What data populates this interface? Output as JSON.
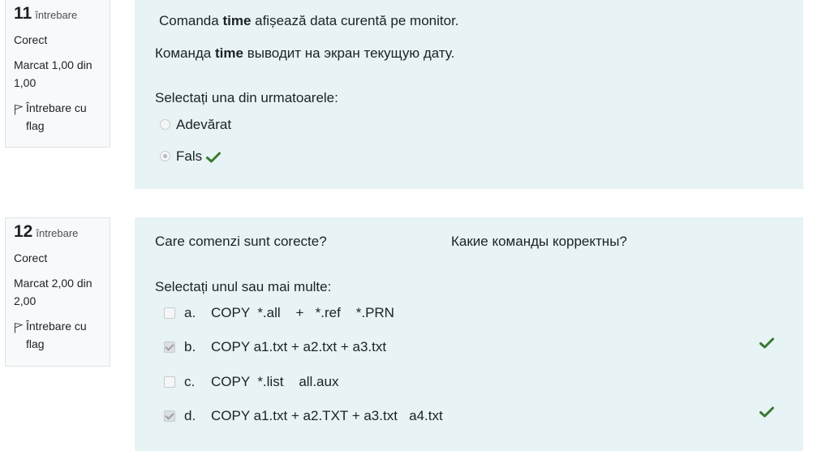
{
  "questions": [
    {
      "number": "11",
      "word": "întrebare",
      "state": "Corect",
      "grade": "Marcat 1,00 din 1,00",
      "flag_label": "Întrebare cu flag",
      "text_ro_pre": "Comanda ",
      "text_ro_bold": "time",
      "text_ro_post": " afișează data curentă pe monitor.",
      "text_ru_pre": "Команда ",
      "text_ru_bold": "time",
      "text_ru_post": " выводит на экран текущую дату.",
      "prompt": "Selectați una din urmatoarele:",
      "answers": [
        {
          "label": "Adevărat",
          "selected": false,
          "correct": false
        },
        {
          "label": "Fals",
          "selected": true,
          "correct": true
        }
      ]
    },
    {
      "number": "12",
      "word": "întrebare",
      "state": "Corect",
      "grade": "Marcat 2,00 din 2,00",
      "flag_label": "Întrebare cu flag",
      "text_ro": "Care comenzi sunt corecte?",
      "text_ru": "Какие команды корректны?",
      "prompt": "Selectați unul sau mai multe:",
      "answers": [
        {
          "letter": "a.",
          "label": "COPY  *.all    +   *.ref    *.PRN",
          "selected": false,
          "correct": false
        },
        {
          "letter": "b.",
          "label": "COPY a1.txt + a2.txt + a3.txt",
          "selected": true,
          "correct": true
        },
        {
          "letter": "c.",
          "label": "COPY  *.list    all.aux",
          "selected": false,
          "correct": false
        },
        {
          "letter": "d.",
          "label": "COPY a1.txt + a2.TXT + a3.txt   a4.txt",
          "selected": true,
          "correct": true
        }
      ]
    }
  ],
  "colors": {
    "content_bg": "#e7f3f5",
    "info_bg": "#f8f9fa",
    "correct_green": "#357a32"
  },
  "icons": {
    "flag": "flag-outline-icon",
    "correct": "check-mark-icon"
  }
}
